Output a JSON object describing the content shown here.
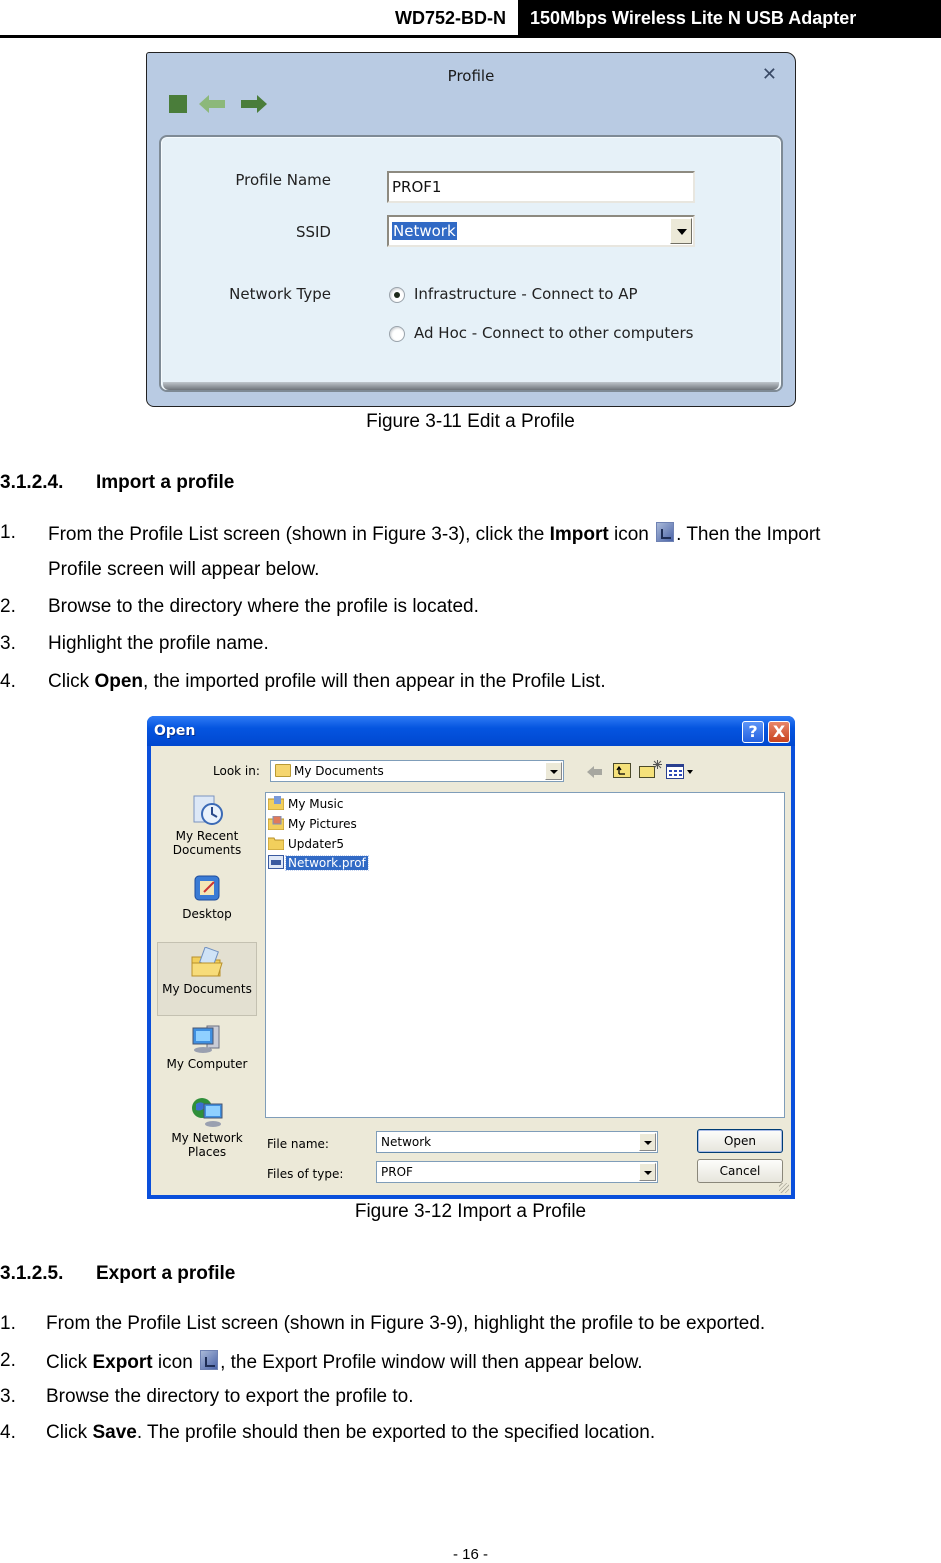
{
  "header": {
    "model": "WD752-BD-N",
    "product": "150Mbps Wireless Lite N USB Adapter"
  },
  "profile_dialog": {
    "title": "Profile",
    "toolbar": {
      "stop_icon": "green-square-icon",
      "back_icon": "arrow-left-icon",
      "forward_icon": "arrow-right-icon"
    },
    "fields": {
      "profile_name_label": "Profile Name",
      "profile_name_value": "PROF1",
      "ssid_label": "SSID",
      "ssid_value": "Network",
      "network_type_label": "Network Type"
    },
    "network_types": [
      {
        "label": "Infrastructure - Connect to AP",
        "selected": true
      },
      {
        "label": "Ad Hoc - Connect to other computers",
        "selected": false
      }
    ]
  },
  "figure_3_11_caption": "Figure 3-11 Edit a Profile",
  "section_import": {
    "number": "3.1.2.4.",
    "title": "Import a profile",
    "steps": [
      {
        "n": "1.",
        "pre": "From the Profile List screen (shown in Figure 3-3), click the ",
        "bold": "Import",
        "mid": " icon ",
        "post": ". Then the Import",
        "cont": "Profile screen will appear below."
      },
      {
        "n": "2.",
        "text": "Browse to the directory where the profile is located."
      },
      {
        "n": "3.",
        "text": "Highlight the profile name."
      },
      {
        "n": "4.",
        "pre": "Click ",
        "bold": "Open",
        "post": ", the imported profile will then appear in the Profile List."
      }
    ]
  },
  "open_dialog": {
    "title": "Open",
    "help_button": "?",
    "close_button": "X",
    "look_in_label": "Look in:",
    "look_in_value": "My Documents",
    "places": [
      "My Recent Documents",
      "Desktop",
      "My Documents",
      "My Computer",
      "My Network Places"
    ],
    "places_lines": [
      [
        "My Recent",
        "Documents"
      ],
      [
        "Desktop"
      ],
      [
        "My Documents"
      ],
      [
        "My Computer"
      ],
      [
        "My Network",
        "Places"
      ]
    ],
    "selected_place": "My Documents",
    "files": [
      {
        "name": "My Music",
        "type": "folder",
        "selected": false
      },
      {
        "name": "My Pictures",
        "type": "folder",
        "selected": false
      },
      {
        "name": "Updater5",
        "type": "folder",
        "selected": false
      },
      {
        "name": "Network.prof",
        "type": "file",
        "selected": true
      }
    ],
    "file_name_label": "File name:",
    "file_name_value": "Network",
    "files_of_type_label": "Files of type:",
    "files_of_type_value": "PROF",
    "open_button": "Open",
    "cancel_button": "Cancel"
  },
  "figure_3_12_caption": "Figure 3-12 Import a Profile",
  "section_export": {
    "number": "3.1.2.5.",
    "title": "Export a profile",
    "steps": [
      {
        "n": "1.",
        "text": "From the Profile List screen (shown in Figure 3-9), highlight the profile to be exported."
      },
      {
        "n": "2.",
        "pre": "Click ",
        "bold": "Export",
        "mid": " icon ",
        "post": ", the Export Profile window will then appear below."
      },
      {
        "n": "3.",
        "text": "Browse the directory to export the profile to."
      },
      {
        "n": "4.",
        "pre": "Click ",
        "bold": "Save",
        "post": ". The profile should then be exported to the specified location."
      }
    ]
  },
  "page_number": "- 16 -"
}
